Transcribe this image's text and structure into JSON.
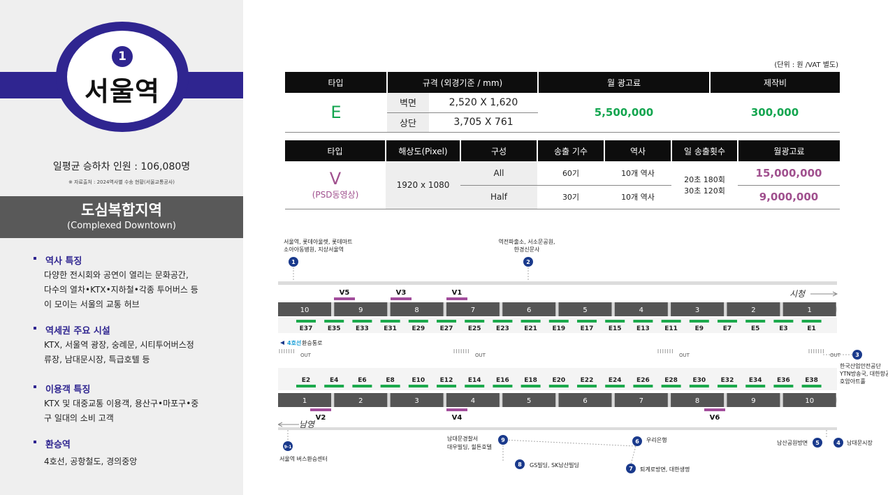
{
  "left": {
    "badge_number": "1",
    "station_name": "서울역",
    "ridership": "일평균 승하차 인원 : 106,080명",
    "source": "※ 자료출처 : 2024역사별 수송 현황(서울교통공사)",
    "zone_title": "도심복합지역",
    "zone_subtitle": "(Complexed Downtown)",
    "features": [
      {
        "heading": "역사 특징",
        "lines": [
          "다양한 전시회와 공연이 열리는 문화공간,",
          "다수의 열차•KTX•지하철•각종 투어버스 등",
          "이 모이는 서울의 교통 허브"
        ]
      },
      {
        "heading": "역세권 주요 시설",
        "lines": [
          "KTX, 서울역 광장, 숭례문, 시티투어버스정",
          "류장, 남대문시장, 특급호텔 등"
        ]
      },
      {
        "heading": "이용객 특징",
        "lines": [
          "KTX 및 대중교통 이용객, 용산구•마포구•중",
          "구 일대의 소비 고객"
        ]
      },
      {
        "heading": "환승역",
        "lines": [
          "4호선, 공항철도, 경의중앙"
        ]
      }
    ]
  },
  "unit_note": "(단위 : 원 /VAT 별도)",
  "table1": {
    "headers": [
      "타입",
      "규격 (외경기준 / mm)",
      "월 광고료",
      "제작비"
    ],
    "type": "E",
    "rows": [
      {
        "label": "벽면",
        "size": "2,520 X 1,620"
      },
      {
        "label": "상단",
        "size": "3,705 X 761"
      }
    ],
    "monthly_fee": "5,500,000",
    "production_cost": "300,000"
  },
  "table2": {
    "headers": [
      "타입",
      "해상도(Pixel)",
      "구성",
      "송출 기수",
      "역사",
      "일 송출횟수",
      "월광고료"
    ],
    "type": "V",
    "type_sub": "(PSD동영상)",
    "resolution": "1920 x 1080",
    "daily_1": "20초 180회",
    "daily_2": "30초 120회",
    "rows": [
      {
        "mode": "All",
        "units": "60기",
        "stations": "10개 역사",
        "fee": "15,000,000"
      },
      {
        "mode": "Half",
        "units": "30기",
        "stations": "10개 역사",
        "fee": "9,000,000"
      }
    ]
  },
  "map": {
    "top_exits": [
      {
        "num": "1",
        "text1": "서울역, 롯데아울렛, 롯데마트",
        "text2": "소아아동병원, 지상서울역"
      },
      {
        "num": "2",
        "text1": "역전파출소, 서소문공원,",
        "text2": "한경신문사"
      }
    ],
    "direction_top": "시청",
    "direction_bottom": "남영",
    "transfer_label": "4호선",
    "transfer_text": "환승통로",
    "out_label": "OUT",
    "top_doors": [
      "10",
      "9",
      "8",
      "7",
      "6",
      "5",
      "4",
      "3",
      "2",
      "1"
    ],
    "bottom_doors": [
      "1",
      "2",
      "3",
      "4",
      "5",
      "6",
      "7",
      "8",
      "9",
      "10"
    ],
    "top_e_codes": [
      "E37",
      "E35",
      "E33",
      "E31",
      "E29",
      "E27",
      "E25",
      "E23",
      "E21",
      "E19",
      "E17",
      "E15",
      "E13",
      "E11",
      "E9",
      "E7",
      "E5",
      "E3",
      "E1"
    ],
    "bottom_e_codes": [
      "E2",
      "E4",
      "E6",
      "E8",
      "E10",
      "E12",
      "E14",
      "E16",
      "E18",
      "E20",
      "E22",
      "E24",
      "E26",
      "E28",
      "E30",
      "E32",
      "E34",
      "E36",
      "E38"
    ],
    "top_v": [
      "V5",
      "V3",
      "V1"
    ],
    "bottom_v": [
      "V2",
      "V4",
      "V6"
    ],
    "exit3": {
      "num": "3",
      "lines": [
        "한국산업안전공단",
        "YTN방송국, 대한항공",
        "호암아트홀"
      ]
    },
    "bottom_exits": [
      {
        "num": "9-1",
        "text": "서울역 버스환승센터"
      },
      {
        "num": "9",
        "text1": "남대문경찰서",
        "text2": "대우빌딩, 힐튼호텔"
      },
      {
        "num": "8",
        "text": "GS빌딩, SK남산빌딩"
      },
      {
        "num": "6",
        "text": "우리은행"
      },
      {
        "num": "7",
        "text": "퇴계로방면, 대한생명"
      },
      {
        "num": "5",
        "text": "남산공원방면"
      },
      {
        "num": "4",
        "text": "남대문시장"
      }
    ],
    "colors": {
      "green": "#1ca94c",
      "purple": "#a24d9b",
      "navy": "#1a3a8c",
      "door": "#555555"
    }
  }
}
